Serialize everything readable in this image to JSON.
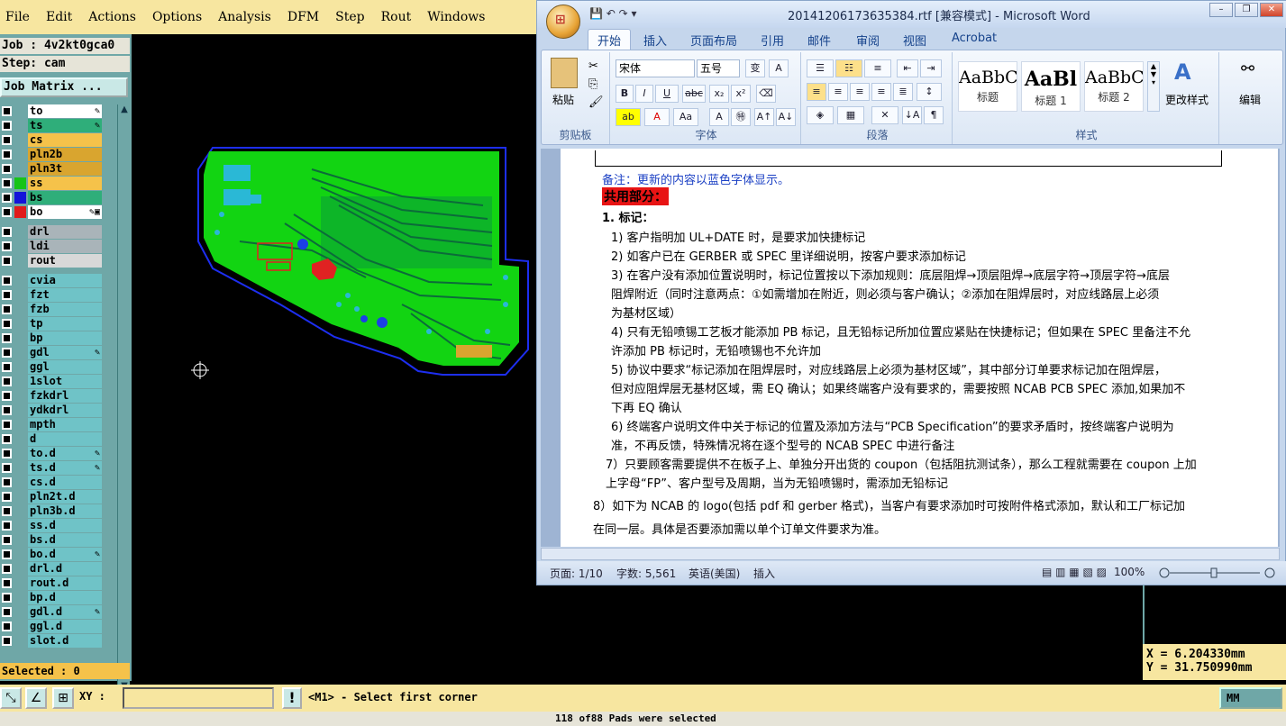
{
  "cam": {
    "menu": [
      "File",
      "Edit",
      "Actions",
      "Options",
      "Analysis",
      "DFM",
      "Step",
      "Rout",
      "Windows"
    ],
    "job_line": "Job : 4v2kt0gca0",
    "step_line": "Step: cam",
    "job_matrix": "Job Matrix ...",
    "layers": [
      {
        "name": "to",
        "color": "#ffffff",
        "swatch": "",
        "flag": "✎"
      },
      {
        "name": "ts",
        "color": "#2fae7a",
        "swatch": "",
        "flag": "✎"
      },
      {
        "name": "cs",
        "color": "#f5c24a",
        "swatch": "",
        "flag": ""
      },
      {
        "name": "pln2b",
        "color": "#d9a52f",
        "swatch": "",
        "flag": ""
      },
      {
        "name": "pln3t",
        "color": "#d9a52f",
        "swatch": "",
        "flag": ""
      },
      {
        "name": "ss",
        "color": "#f5c24a",
        "swatch": "#17c417",
        "flag": ""
      },
      {
        "name": "bs",
        "color": "#2fae7a",
        "swatch": "#1313d9",
        "flag": ""
      },
      {
        "name": "bo",
        "color": "#ffffff",
        "swatch": "#e01b1b",
        "flag": "✎▣"
      },
      {
        "name": "drl",
        "color": "#a9b4b9",
        "swatch": "",
        "flag": ""
      },
      {
        "name": "ldi",
        "color": "#a9b4b9",
        "swatch": "",
        "flag": ""
      },
      {
        "name": "rout",
        "color": "#d8d8d8",
        "swatch": "",
        "flag": ""
      },
      {
        "name": "cvia",
        "color": "#6fc3c7",
        "swatch": "",
        "flag": ""
      },
      {
        "name": "fzt",
        "color": "#6fc3c7",
        "swatch": "",
        "flag": ""
      },
      {
        "name": "fzb",
        "color": "#6fc3c7",
        "swatch": "",
        "flag": ""
      },
      {
        "name": "tp",
        "color": "#6fc3c7",
        "swatch": "",
        "flag": ""
      },
      {
        "name": "bp",
        "color": "#6fc3c7",
        "swatch": "",
        "flag": ""
      },
      {
        "name": "gdl",
        "color": "#6fc3c7",
        "swatch": "",
        "flag": "✎"
      },
      {
        "name": "ggl",
        "color": "#6fc3c7",
        "swatch": "",
        "flag": ""
      },
      {
        "name": "1slot",
        "color": "#6fc3c7",
        "swatch": "",
        "flag": ""
      },
      {
        "name": "fzkdrl",
        "color": "#6fc3c7",
        "swatch": "",
        "flag": ""
      },
      {
        "name": "ydkdrl",
        "color": "#6fc3c7",
        "swatch": "",
        "flag": ""
      },
      {
        "name": "mpth",
        "color": "#6fc3c7",
        "swatch": "",
        "flag": ""
      },
      {
        "name": "d",
        "color": "#6fc3c7",
        "swatch": "",
        "flag": ""
      },
      {
        "name": "to.d",
        "color": "#6fc3c7",
        "swatch": "",
        "flag": "✎"
      },
      {
        "name": "ts.d",
        "color": "#6fc3c7",
        "swatch": "",
        "flag": "✎"
      },
      {
        "name": "cs.d",
        "color": "#6fc3c7",
        "swatch": "",
        "flag": ""
      },
      {
        "name": "pln2t.d",
        "color": "#6fc3c7",
        "swatch": "",
        "flag": ""
      },
      {
        "name": "pln3b.d",
        "color": "#6fc3c7",
        "swatch": "",
        "flag": ""
      },
      {
        "name": "ss.d",
        "color": "#6fc3c7",
        "swatch": "",
        "flag": ""
      },
      {
        "name": "bs.d",
        "color": "#6fc3c7",
        "swatch": "",
        "flag": ""
      },
      {
        "name": "bo.d",
        "color": "#6fc3c7",
        "swatch": "",
        "flag": "✎"
      },
      {
        "name": "drl.d",
        "color": "#6fc3c7",
        "swatch": "",
        "flag": ""
      },
      {
        "name": "rout.d",
        "color": "#6fc3c7",
        "swatch": "",
        "flag": ""
      },
      {
        "name": "bp.d",
        "color": "#6fc3c7",
        "swatch": "",
        "flag": ""
      },
      {
        "name": "gdl.d",
        "color": "#6fc3c7",
        "swatch": "",
        "flag": "✎"
      },
      {
        "name": "ggl.d",
        "color": "#6fc3c7",
        "swatch": "",
        "flag": ""
      },
      {
        "name": "slot.d",
        "color": "#6fc3c7",
        "swatch": "",
        "flag": ""
      }
    ],
    "selected": "Selected : 0",
    "xy_label": "XY :",
    "prompt": "<M1> - Select first corner",
    "units": "MM",
    "coord_x": "X = 6.204330mm",
    "coord_y": "Y = 31.750990mm",
    "status": "118 of88 Pads were selected"
  },
  "word": {
    "title": "20141206173635384.rtf [兼容模式] - Microsoft Word",
    "tabs": [
      "开始",
      "插入",
      "页面布局",
      "引用",
      "邮件",
      "审阅",
      "视图",
      "Acrobat"
    ],
    "groups": {
      "clipboard": "剪贴板",
      "font": "字体",
      "paragraph": "段落",
      "styles": "样式",
      "edit": "编辑"
    },
    "paste": "粘贴",
    "font_name": "宋体",
    "font_size": "五号",
    "styles": [
      {
        "preview": "AaBbC",
        "name": "标题"
      },
      {
        "preview": "AaBl",
        "name": "标题 1"
      },
      {
        "preview": "AaBbC",
        "name": "标题 2"
      }
    ],
    "change_styles": "更改样式",
    "edit_label": "编辑",
    "doc": {
      "note": "备注：更新的内容以蓝色字体显示。",
      "section": "共用部分：",
      "heading": "1.   标记：",
      "items": [
        "1)  客户指明加 UL+DATE 时，是要求加快捷标记",
        "2)  如客户已在 GERBER 或 SPEC 里详细说明，按客户要求添加标记",
        "3)  在客户没有添加位置说明时，标记位置按以下添加规则：底层阻焊→顶层阻焊→底层字符→顶层字符→底层",
        "     阻焊附近（同时注意两点：①如需增加在附近，则必须与客户确认；②添加在阻焊层时，对应线路层上必须",
        "     为基材区域）",
        "4)  只有无铅喷锡工艺板才能添加 PB 标记，且无铅标记所加位置应紧贴在快捷标记；但如果在 SPEC 里备注不允",
        "     许添加 PB 标记时，无铅喷锡也不允许加",
        "5)  协议中要求“标记添加在阻焊层时，对应线路层上必须为基材区域”，其中部分订单要求标记加在阻焊层，",
        "     但对应阻焊层无基材区域，需 EQ 确认；如果终端客户没有要求的，需要按照 NCAB PCB SPEC 添加,如果加不",
        "     下再 EQ 确认",
        "6)  终端客户说明文件中关于标记的位置及添加方法与“PCB Specification”的要求矛盾时，按终端客户说明为",
        "     准，不再反馈，特殊情况将在逐个型号的 NCAB SPEC 中进行备注",
        "  7）只要顾客需要提供不在板子上、单独分开出货的 coupon（包括阻抗测试条），那么工程就需要在 coupon 上加",
        "  上字母“FP”、客户型号及周期，当为无铅喷锡时，需添加无铅标记",
        "    8）如下为 NCAB 的 logo(包括 pdf 和 gerber 格式)，当客户有要求添加时可按附件格式添加，默认和工厂标记加",
        "在同一层。具体是否要添加需以单个订单文件要求为准。"
      ]
    },
    "status": {
      "page": "页面: 1/10",
      "words": "字数: 5,561",
      "lang": "英语(美国)",
      "mode": "插入",
      "zoom": "100%"
    }
  }
}
